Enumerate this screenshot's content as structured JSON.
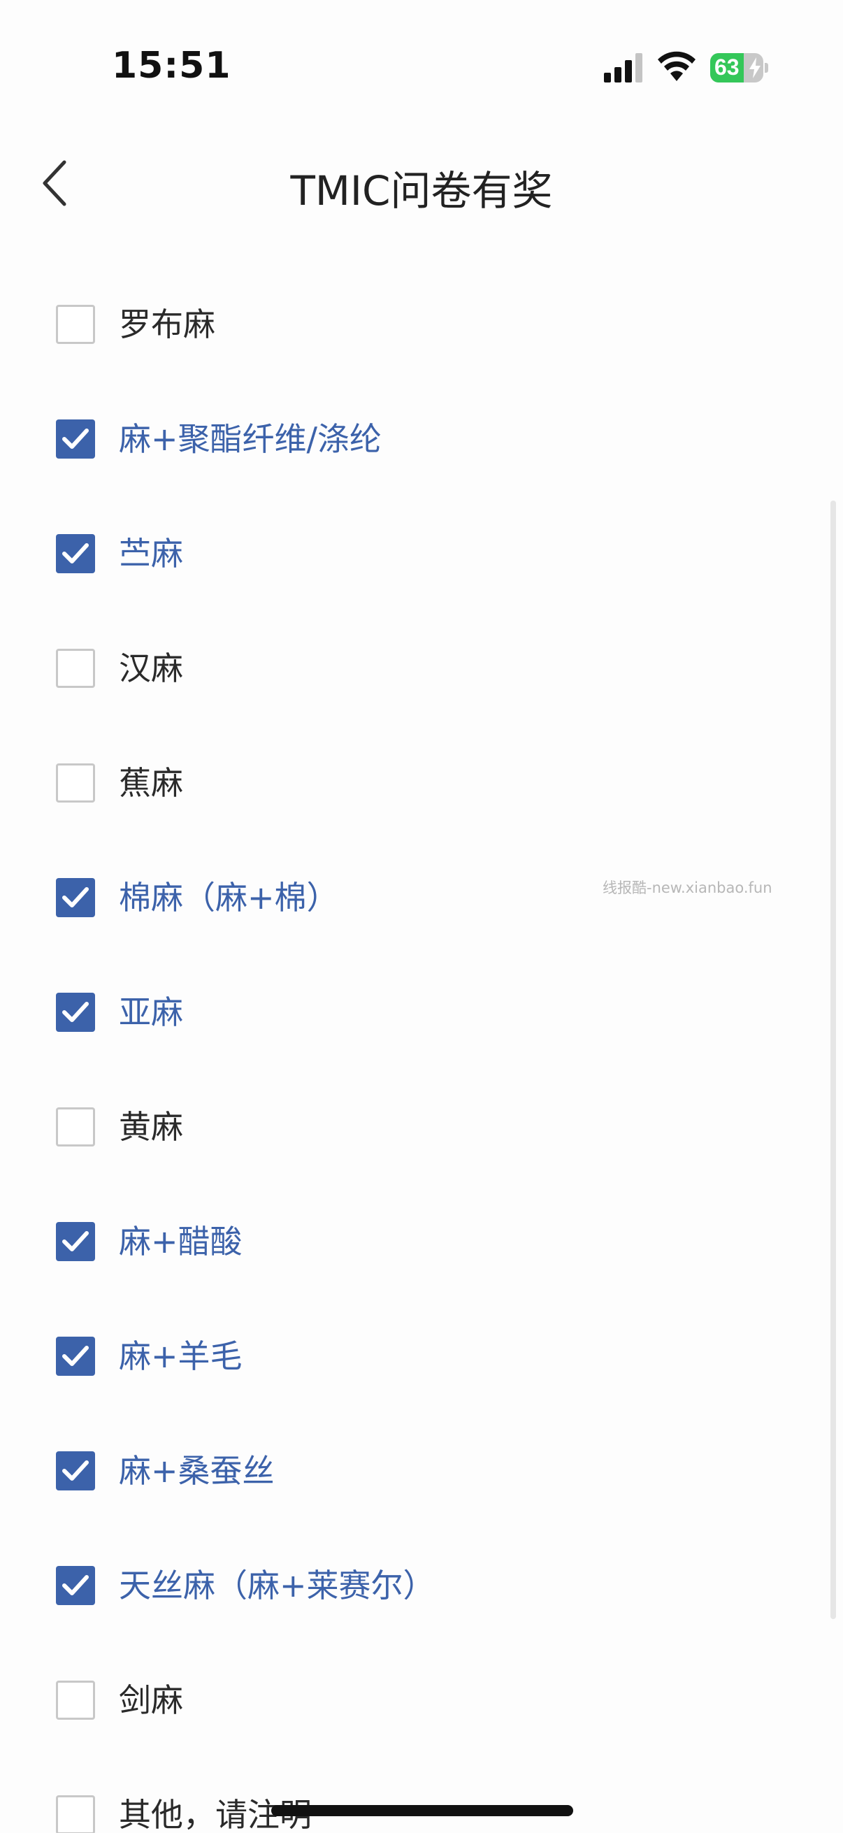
{
  "status_bar": {
    "time": "15:51",
    "battery_level": 63,
    "battery_label": "63",
    "battery_charging": true,
    "icons": [
      "signal-icon",
      "wifi-icon",
      "battery-icon",
      "charging-bolt-icon"
    ]
  },
  "header": {
    "title": "TMIC问卷有奖",
    "back_icon": "chevron-left-icon"
  },
  "options": [
    {
      "label": "",
      "checked": false
    },
    {
      "label": "罗布麻",
      "checked": false
    },
    {
      "label": "麻+聚酯纤维/涤纶",
      "checked": true
    },
    {
      "label": "苎麻",
      "checked": true
    },
    {
      "label": "汉麻",
      "checked": false
    },
    {
      "label": "蕉麻",
      "checked": false
    },
    {
      "label": "棉麻（麻+棉）",
      "checked": true
    },
    {
      "label": "亚麻",
      "checked": true
    },
    {
      "label": "黄麻",
      "checked": false
    },
    {
      "label": "麻+醋酸",
      "checked": true
    },
    {
      "label": "麻+羊毛",
      "checked": true
    },
    {
      "label": "麻+桑蚕丝",
      "checked": true
    },
    {
      "label": "天丝麻（麻+莱赛尔）",
      "checked": true
    },
    {
      "label": "剑麻",
      "checked": false
    },
    {
      "label": "其他，请注明",
      "checked": false
    }
  ],
  "watermark": "线报酷-new.xianbao.fun",
  "colors": {
    "accent": "#3c62aa",
    "unchecked_border": "#c8c8c8",
    "text": "#2a2a2a",
    "battery_green": "#34c759"
  }
}
